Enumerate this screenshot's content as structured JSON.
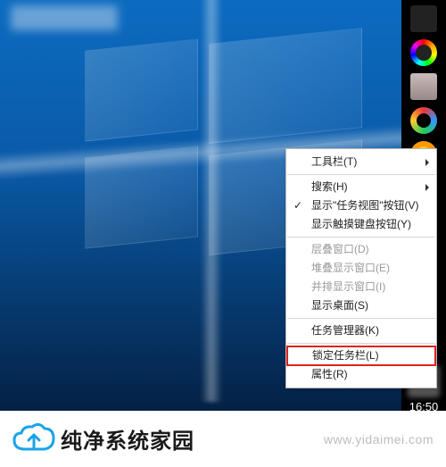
{
  "taskbar_right": {
    "clock_time": "16:50"
  },
  "context_menu": {
    "items": [
      {
        "label": "工具栏(T)",
        "arrow": true,
        "disabled": false,
        "check": false
      },
      {
        "sep": true
      },
      {
        "label": "搜索(H)",
        "arrow": true,
        "disabled": false,
        "check": false
      },
      {
        "label": "显示\"任务视图\"按钮(V)",
        "arrow": false,
        "disabled": false,
        "check": true
      },
      {
        "label": "显示触摸键盘按钮(Y)",
        "arrow": false,
        "disabled": false,
        "check": false
      },
      {
        "sep": true
      },
      {
        "label": "层叠窗口(D)",
        "arrow": false,
        "disabled": true,
        "check": false
      },
      {
        "label": "堆叠显示窗口(E)",
        "arrow": false,
        "disabled": true,
        "check": false
      },
      {
        "label": "并排显示窗口(I)",
        "arrow": false,
        "disabled": true,
        "check": false
      },
      {
        "label": "显示桌面(S)",
        "arrow": false,
        "disabled": false,
        "check": false
      },
      {
        "sep": true
      },
      {
        "label": "任务管理器(K)",
        "arrow": false,
        "disabled": false,
        "check": false
      },
      {
        "sep": true
      },
      {
        "label": "锁定任务栏(L)",
        "arrow": false,
        "disabled": false,
        "check": false,
        "highlight": true
      },
      {
        "label": "属性(R)",
        "arrow": false,
        "disabled": false,
        "check": false
      }
    ]
  },
  "footer": {
    "brand_text": "纯净系统家园",
    "watermark_url": "www.yidaimei.com"
  }
}
